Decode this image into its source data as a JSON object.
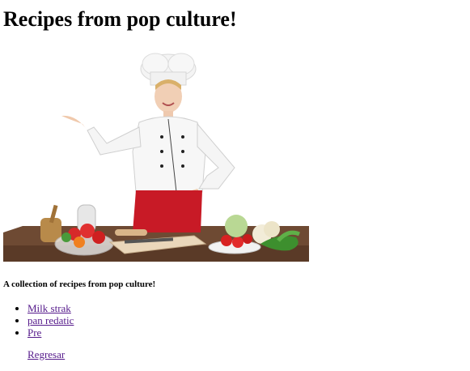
{
  "page": {
    "title": "Recipes from pop culture!",
    "subtitle": "A collection of recipes from pop culture!"
  },
  "recipes": [
    {
      "label": "Milk strak"
    },
    {
      "label": "pan redatic"
    },
    {
      "label": "Pre"
    }
  ],
  "back_link": {
    "label": "Regresar"
  },
  "colors": {
    "link_visited": "#551a8b",
    "text": "#000000",
    "background": "#ffffff"
  }
}
